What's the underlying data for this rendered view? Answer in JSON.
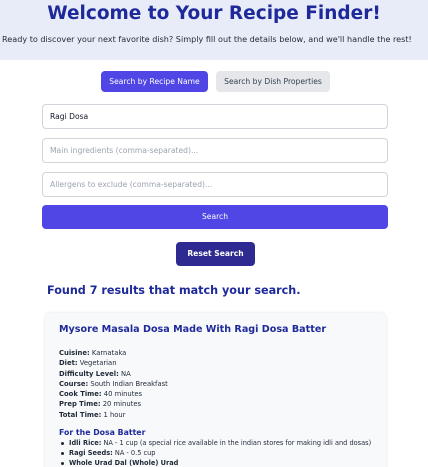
{
  "header": {
    "title": "Welcome to Your Recipe Finder!",
    "subtitle": "Ready to discover your next favorite dish? Simply fill out the details below, and we'll handle the rest!"
  },
  "tabs": [
    {
      "label": "Search by Recipe Name",
      "active": true
    },
    {
      "label": "Search by Dish Properties",
      "active": false
    }
  ],
  "form": {
    "recipe_name_value": "Ragi Dosa",
    "ingredients_placeholder": "Main ingredients (comma-separated)...",
    "allergens_placeholder": "Allergens to exclude (comma-separated)...",
    "search_label": "Search",
    "reset_label": "Reset Search"
  },
  "results": {
    "heading": "Found 7 results that match your search."
  },
  "card": {
    "title": "Mysore Masala Dosa Made With Ragi Dosa Batter",
    "details": [
      {
        "label": "Cuisine:",
        "value": "Karnataka"
      },
      {
        "label": "Diet:",
        "value": "Vegetarian"
      },
      {
        "label": "Difficulty Level:",
        "value": "NA"
      },
      {
        "label": "Course:",
        "value": "South Indian Breakfast"
      },
      {
        "label": "Cook Time:",
        "value": "40 minutes"
      },
      {
        "label": "Prep Time:",
        "value": "20 minutes"
      },
      {
        "label": "Total Time:",
        "value": "1 hour"
      }
    ],
    "section_title": "For the Dosa Batter",
    "ingredients": [
      {
        "name": "Idli Rice:",
        "value": "NA - 1 cup (a special rice available in the indian stores for making idli and dosas)"
      },
      {
        "name": "Ragi Seeds:",
        "value": "NA - 0.5 cup"
      },
      {
        "name": "Whole Urad Dal (Whole) Urad",
        "value": ""
      }
    ]
  },
  "colors": {
    "primary": "#4f46e5",
    "heading": "#1e2a9a",
    "reset": "#2e2a91",
    "hero_bg": "#e8ebf8"
  }
}
